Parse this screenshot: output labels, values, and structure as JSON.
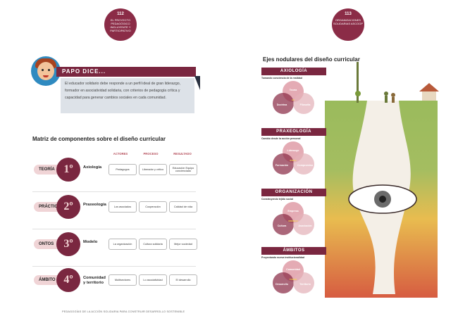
{
  "left_page": {
    "badge": {
      "number": "112",
      "text": "EL PROYECTO PEDAGÓGICO INCLUYENTE Y PARTICIPATIVO"
    },
    "papo": {
      "title": "PAPO DICE...",
      "text": "El educador solidario debe responde a un perfil ideal de gran liderazgo, formador en asociatividad solidaria, con criterios de pedagogía crítica y capacidad para generar cambios sociales en cada comunidad."
    },
    "matrix": {
      "title": "Matriz de componentes sobre el diseño curricular",
      "columns": [
        "ACTORES",
        "PROCESO",
        "RESULTADO"
      ],
      "rows": [
        {
          "tag": "TEORÍA",
          "ordinal": "1º",
          "name": "Axiología",
          "cells": [
            "Pedagogos",
            "Liberador y crítico",
            "Educación Equipo concienciado"
          ]
        },
        {
          "tag": "PRÁCTICA",
          "ordinal": "2º",
          "name": "Praxeología",
          "cells": [
            "Los asociados",
            "Cooperación",
            "Calidad de vida"
          ]
        },
        {
          "tag": "ONTOS",
          "ordinal": "3º",
          "name": "Modelo",
          "cells": [
            "La organización",
            "Cultura solidaria",
            "Mejor sociedad"
          ]
        },
        {
          "tag": "ÁMBITO",
          "ordinal": "4º",
          "name": "Comunidad y territorio",
          "cells": [
            "Multisectores",
            "Lo asociatividad",
            "El desarrollo"
          ]
        }
      ]
    },
    "footer": "PEDAGOGÍAS DE LA ACCIÓN SOLIDARIA PARA CONSTRUIR DESARROLLO SOSTENIBLE"
  },
  "right_page": {
    "badge": {
      "number": "113",
      "text": "ORGANIZACIONES SOLIDARIAS ASCOOP"
    },
    "title": "Ejes nodulares del diseño curricular",
    "sections": [
      {
        "bar": "AXIOLOGÍA",
        "sub": "Tomando conciencia de la realidad",
        "top": "Teoría",
        "left": "Doctrina",
        "right": "Filosofía",
        "mid": "AX"
      },
      {
        "bar": "PRAXEOLOGÍA",
        "sub": "Cambio desde la acción personal",
        "top": "Liderazgo",
        "left": "Formación",
        "right": "Compromiso",
        "mid": "ÉTICA"
      },
      {
        "bar": "ORGANIZACIÓN",
        "sub": "Construyendo tejido social",
        "top": "Empresa",
        "left": "Cultura",
        "right": "Asociación",
        "mid": "MODELO"
      },
      {
        "bar": "ÁMBITOS",
        "sub": "Proyectando nueva institucionalidad",
        "top": "Comunidad",
        "left": "Desarrollo",
        "right": "Territorio",
        "mid": "TODOS"
      }
    ]
  },
  "colors": {
    "accent": "#7a2740",
    "pink": "#f0d4d6",
    "box": "#dde2e8"
  }
}
